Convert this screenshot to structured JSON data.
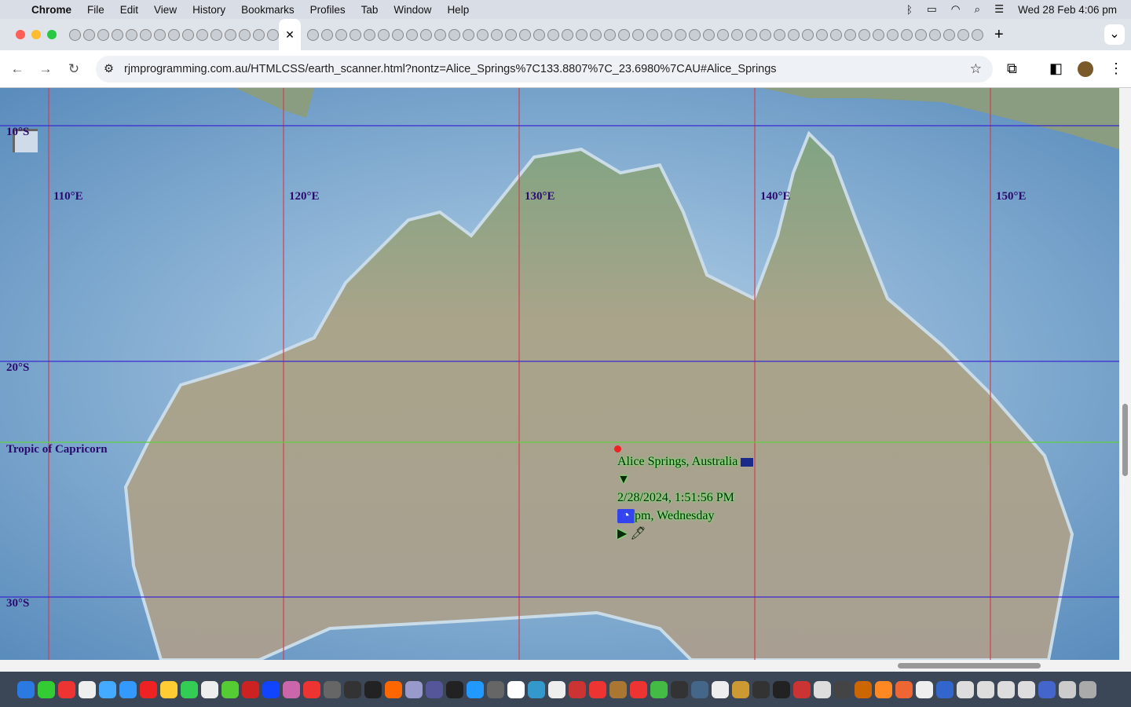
{
  "menubar": {
    "app": "Chrome",
    "items": [
      "File",
      "Edit",
      "View",
      "History",
      "Bookmarks",
      "Profiles",
      "Tab",
      "Window",
      "Help"
    ],
    "clock": "Wed 28 Feb  4:06 pm"
  },
  "browser": {
    "url": "rjmprogramming.com.au/HTMLCSS/earth_scanner.html?nontz=Alice_Springs%7C133.8807%7C_23.6980%7CAU#Alice_Springs",
    "new_tab": "+",
    "close_tab": "✕"
  },
  "map": {
    "longitudes": [
      "110°E",
      "120°E",
      "130°E",
      "140°E",
      "150°E"
    ],
    "latitudes": [
      "10°S",
      "20°S",
      "30°S"
    ],
    "tropic": "Tropic of Capricorn",
    "colors": {
      "longitude_line": "#d04050",
      "latitude_line": "#3a2ad0",
      "tropic_line": "#60d040"
    }
  },
  "popup": {
    "place": "Alice Springs, Australia",
    "toggle_open": "▼",
    "datetime": "2/28/2024, 1:51:56 PM",
    "day": "pm, Wednesday",
    "toggle_closed": "▶"
  }
}
